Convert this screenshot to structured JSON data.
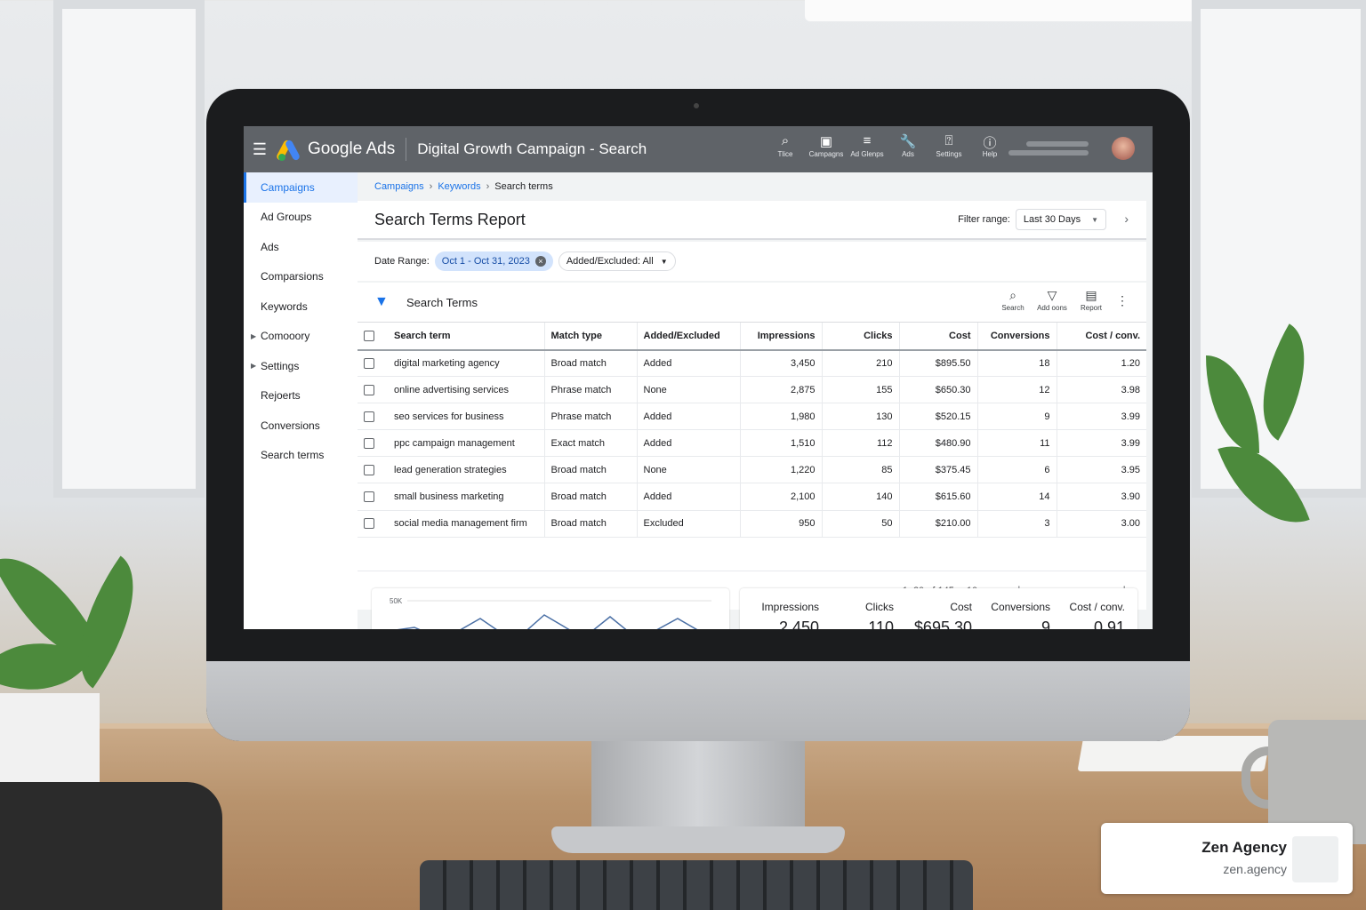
{
  "app": {
    "brand": "Google Ads",
    "campaign_title": "Digital Growth Campaign - Search",
    "top_icons": [
      {
        "label": "Tlice",
        "icon": "search-icon"
      },
      {
        "label": "Campagns",
        "icon": "campaigns-icon"
      },
      {
        "label": "Ad Glenps",
        "icon": "ad-groups-icon"
      },
      {
        "label": "Ads",
        "icon": "wrench-icon"
      },
      {
        "label": "Settings",
        "icon": "settings-icon"
      },
      {
        "label": "Help",
        "icon": "help-icon"
      }
    ]
  },
  "sidebar": {
    "items": [
      {
        "label": "Campaigns",
        "active": true
      },
      {
        "label": "Ad Groups"
      },
      {
        "label": "Ads"
      },
      {
        "label": "Comparsions"
      },
      {
        "label": "Keywords"
      },
      {
        "label": "Comooory",
        "expandable": true
      },
      {
        "label": "Settings",
        "expandable": true
      },
      {
        "label": "Rejoerts"
      },
      {
        "label": "Conversions"
      },
      {
        "label": "Search terms"
      }
    ]
  },
  "breadcrumb": {
    "c1": "Campaigns",
    "c2": "Keywords",
    "c3": "Search terms"
  },
  "report": {
    "title": "Search Terms Report",
    "filter_label": "Filter range:",
    "filter_value": "Last 30 Days"
  },
  "filters": {
    "date_label": "Date Range:",
    "date_value": "Oct 1 - Oct 31, 2023",
    "added_excluded": "Added/Excluded: All"
  },
  "table": {
    "title": "Search Terms",
    "tools": {
      "search": "Search",
      "addons": "Add oons",
      "report": "Report"
    },
    "headers": {
      "term": "Search term",
      "match": "Match type",
      "added": "Added/Excluded",
      "impr": "Impressions",
      "clicks": "Clicks",
      "cost": "Cost",
      "conv": "Conversions",
      "cpc": "Cost / conv."
    },
    "rows": [
      {
        "term": "digital marketing agency",
        "match": "Broad match",
        "added": "Added",
        "impr": "3,450",
        "clicks": "210",
        "cost": "$895.50",
        "conv": "18",
        "cpc": "1.20"
      },
      {
        "term": "online advertising services",
        "match": "Phrase match",
        "added": "None",
        "impr": "2,875",
        "clicks": "155",
        "cost": "$650.30",
        "conv": "12",
        "cpc": "3.98"
      },
      {
        "term": "seo services for business",
        "match": "Phrase match",
        "added": "Added",
        "impr": "1,980",
        "clicks": "130",
        "cost": "$520.15",
        "conv": "9",
        "cpc": "3.99"
      },
      {
        "term": "ppc campaign management",
        "match": "Exact match",
        "added": "Added",
        "impr": "1,510",
        "clicks": "112",
        "cost": "$480.90",
        "conv": "11",
        "cpc": "3.99"
      },
      {
        "term": "lead generation strategies",
        "match": "Broad match",
        "added": "None",
        "impr": "1,220",
        "clicks": "85",
        "cost": "$375.45",
        "conv": "6",
        "cpc": "3.95"
      },
      {
        "term": "small business marketing",
        "match": "Broad match",
        "added": "Added",
        "impr": "2,100",
        "clicks": "140",
        "cost": "$615.60",
        "conv": "14",
        "cpc": "3.90"
      },
      {
        "term": "social media management firm",
        "match": "Broad match",
        "added": "Excluded",
        "impr": "950",
        "clicks": "50",
        "cost": "$210.00",
        "conv": "3",
        "cpc": "3.00"
      }
    ]
  },
  "pagination": {
    "range": "1–20 of 145",
    "page_size": "10"
  },
  "summary": {
    "chart_y_label": "50K",
    "cols": [
      {
        "label": "Impressions",
        "value": "2,450"
      },
      {
        "label": "Clicks",
        "value": "110"
      },
      {
        "label": "Cost",
        "value": "$695.30"
      },
      {
        "label": "Conversions",
        "value": "9"
      },
      {
        "label": "Cost / conv.",
        "value": "0.91"
      }
    ]
  },
  "watermark": {
    "name": "Zen Agency",
    "url": "zen.agency"
  },
  "colors": {
    "accent": "#1a73e8",
    "topbar": "#5f6368"
  }
}
